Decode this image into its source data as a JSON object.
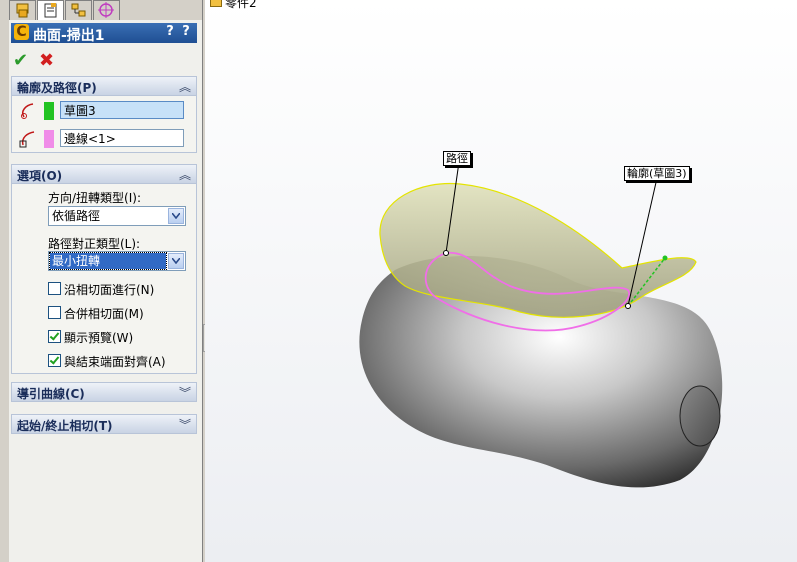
{
  "tree": {
    "item_label": "零件2"
  },
  "property_manager": {
    "title": "曲面-掃出1",
    "help_icons": [
      "?",
      "?"
    ],
    "profile_path_group": {
      "title": "輪廓及路徑(P)",
      "profile": {
        "value": "草圖3",
        "color": "#22c322"
      },
      "path": {
        "value": "邊線<1>",
        "color": "#f08ce8"
      }
    },
    "options_group": {
      "title": "選項(O)",
      "orientation_label": "方向/扭轉類型(I):",
      "orientation_value": "依循路徑",
      "path_align_label": "路徑對正類型(L):",
      "path_align_value": "最小扭轉",
      "checkboxes": [
        {
          "label": "沿相切面進行(N)",
          "checked": false
        },
        {
          "label": "合併相切面(M)",
          "checked": false
        },
        {
          "label": "顯示預覽(W)",
          "checked": true
        },
        {
          "label": "與結束端面對齊(A)",
          "checked": true
        }
      ]
    },
    "guide_curves_group": {
      "title": "導引曲線(C)"
    },
    "start_end_tangency_group": {
      "title": "起始/終止相切(T)"
    }
  },
  "viewport": {
    "callouts": {
      "path": "路徑",
      "profile": "輪廓(草圖3)"
    }
  }
}
